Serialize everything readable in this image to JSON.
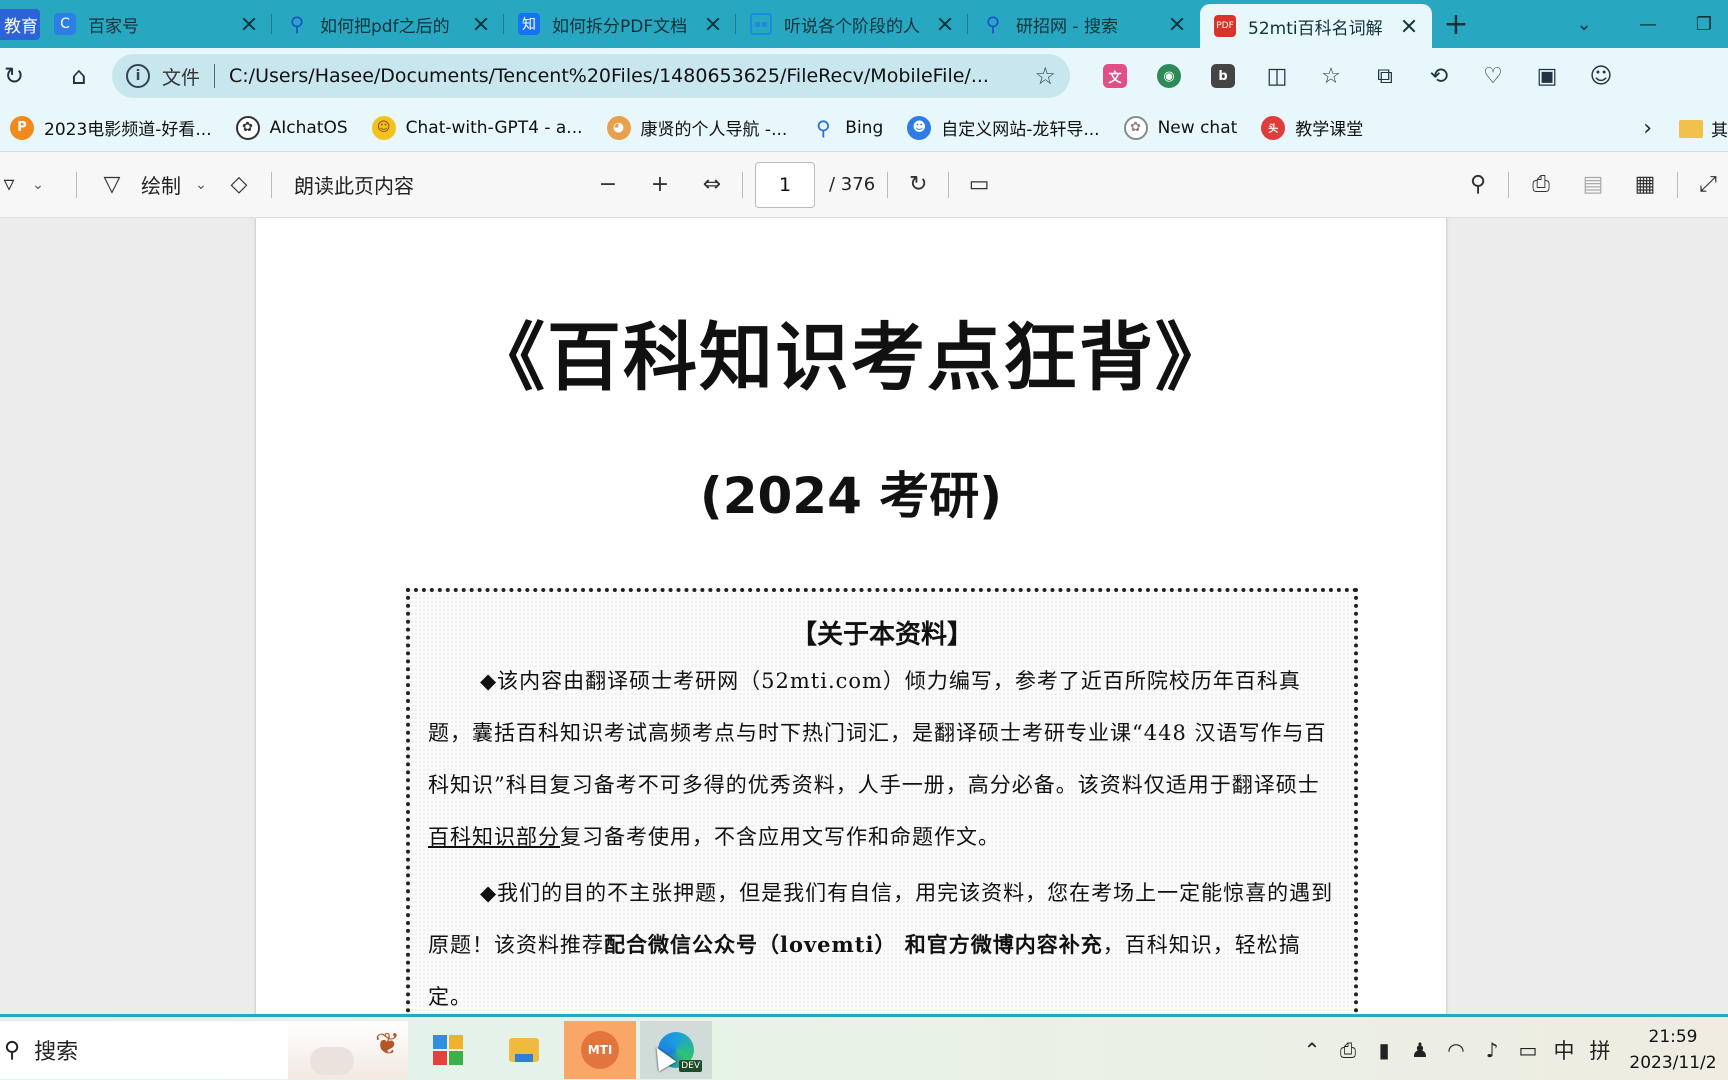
{
  "browser": {
    "tabs": [
      {
        "title": "教育",
        "favicon": "blue-badge",
        "partial": true
      },
      {
        "title": "百家号",
        "favicon": "baijiahao-icon"
      },
      {
        "title": "如何把pdf之后的",
        "favicon": "search-icon"
      },
      {
        "title": "如何拆分PDF文档",
        "favicon": "zhihu-icon"
      },
      {
        "title": "听说各个阶段的人",
        "favicon": "bilibili-icon"
      },
      {
        "title": "研招网 - 搜索",
        "favicon": "search-icon"
      },
      {
        "title": "52mti百科名词解",
        "favicon": "pdf-icon",
        "active": true
      }
    ],
    "address": {
      "label": "文件",
      "url": "C:/Users/Hasee/Documents/Tencent%20Files/1480653625/FileRecv/MobileFile/..."
    },
    "favorites": [
      {
        "label": "2023电影频道-好看...",
        "icon": "p-icon",
        "color": "#f08a1c"
      },
      {
        "label": "AIchatOS",
        "icon": "openai-icon",
        "color": "#333333"
      },
      {
        "label": "Chat-with-GPT4 - a...",
        "icon": "hugface-icon",
        "color": "#f5c21b"
      },
      {
        "label": "康贤的个人导航 -...",
        "icon": "avatar-icon",
        "color": "#e7a04b"
      },
      {
        "label": "Bing",
        "icon": "search-icon",
        "color": "#2a6fd6"
      },
      {
        "label": "自定义网站-龙轩导...",
        "icon": "robot-icon",
        "color": "#2f7ae5"
      },
      {
        "label": "New chat",
        "icon": "openai-icon",
        "color": "#888888"
      },
      {
        "label": "教学课堂",
        "icon": "toutiao-icon",
        "color": "#e23b3b"
      }
    ],
    "favorites_other_label": "其"
  },
  "pdf_toolbar": {
    "draw_label": "绘制",
    "read_aloud_label": "朗读此页内容",
    "page_current": "1",
    "page_total": "/ 376"
  },
  "document": {
    "title": "《百科知识考点狂背》",
    "subtitle": "(2024 考研)",
    "box_heading": "【关于本资料】",
    "para1": "◆该内容由翻译硕士考研网（52mti.com）倾力编写，参考了近百所院校历年百科真题，囊括百科知识考试高频考点与时下热门词汇，是翻译硕士考研专业课“448 汉语写作与百科知识”科目复习备考不可多得的优秀资料，人手一册，高分必备。该资料仅适用于翻译硕士",
    "para1_underlined": "百科知识部分",
    "para1_tail": "复习备考使用，不含应用文写作和命题作文。",
    "para2_start": "◆我们的目的不主张押题，但是我们有自信，用完该资料，您在考场上一定能惊喜的遇到原题！该资料推荐",
    "para2_bold": "配合微信公众号（lovemti） 和官方微博内容补充",
    "para2_tail": "，百科知识，轻松搞定。"
  },
  "taskbar": {
    "search_label": "搜索",
    "mti_label": "MTI",
    "edge_badge": "DEV",
    "ime_lang": "中",
    "ime_mode": "拼",
    "time": "21:59",
    "date": "2023/11/2"
  },
  "colors": {
    "tabstrip": "#28a8c0",
    "active_tab": "#e7f7fb",
    "toolbar": "#e7f7fb"
  }
}
